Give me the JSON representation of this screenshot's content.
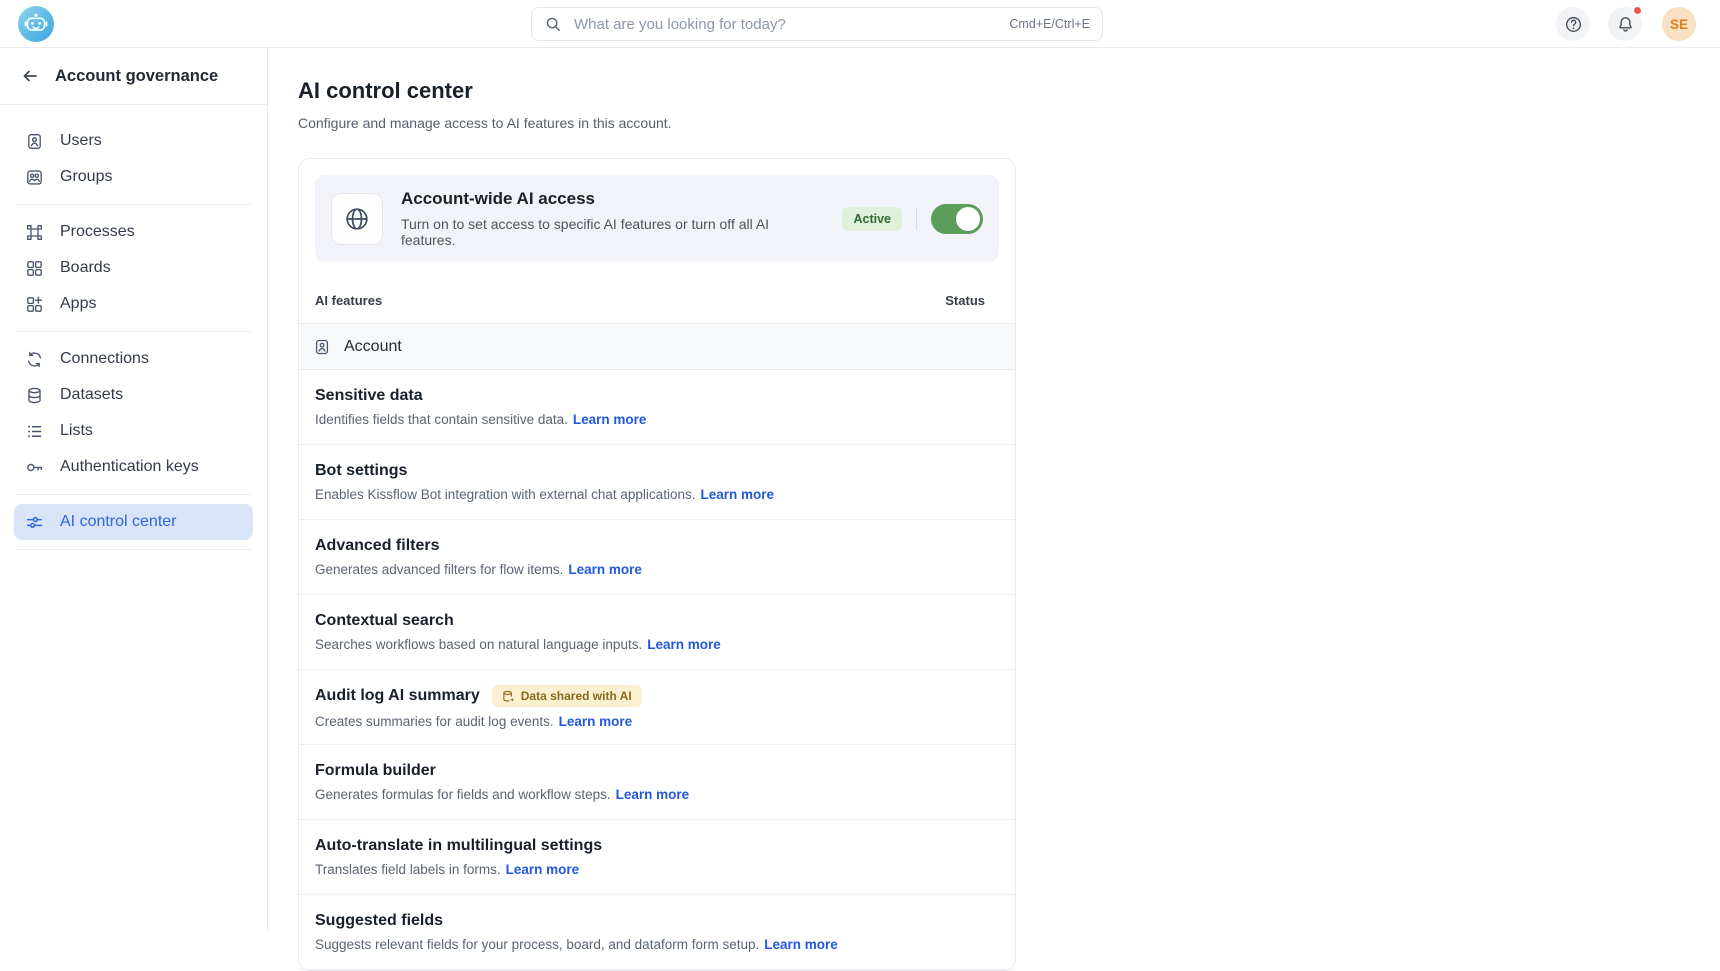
{
  "topbar": {
    "search": {
      "placeholder": "What are you looking for today?",
      "shortcut": "Cmd+E/Ctrl+E"
    },
    "avatar_initials": "SE",
    "has_notification": true
  },
  "sidebar": {
    "title": "Account governance",
    "items": [
      {
        "label": "Users",
        "icon": "user-badge-icon",
        "selected": false,
        "divider_after": false
      },
      {
        "label": "Groups",
        "icon": "users-group-icon",
        "selected": false,
        "divider_after": true
      },
      {
        "label": "Processes",
        "icon": "processes-icon",
        "selected": false,
        "divider_after": false
      },
      {
        "label": "Boards",
        "icon": "boards-icon",
        "selected": false,
        "divider_after": false
      },
      {
        "label": "Apps",
        "icon": "apps-icon",
        "selected": false,
        "divider_after": true
      },
      {
        "label": "Connections",
        "icon": "connections-icon",
        "selected": false,
        "divider_after": false
      },
      {
        "label": "Datasets",
        "icon": "datasets-icon",
        "selected": false,
        "divider_after": false
      },
      {
        "label": "Lists",
        "icon": "lists-icon",
        "selected": false,
        "divider_after": false
      },
      {
        "label": "Authentication keys",
        "icon": "key-icon",
        "selected": false,
        "divider_after": true
      },
      {
        "label": "AI control center",
        "icon": "sliders-icon",
        "selected": true,
        "divider_after": true
      }
    ]
  },
  "main": {
    "title": "AI control center",
    "subtitle": "Configure and manage access to AI features in this account.",
    "access_card": {
      "title": "Account-wide AI access",
      "description": "Turn on to set access to specific AI features or turn off all AI features.",
      "status_badge": "Active",
      "toggle_on": true
    },
    "table": {
      "column_features": "AI features",
      "column_status": "Status",
      "section_label": "Account",
      "rows": [
        {
          "name": "Sensitive data",
          "description": "Identifies fields that contain sensitive data.",
          "link": "Learn more",
          "toggle_on": true
        },
        {
          "name": "Bot settings",
          "description": "Enables Kissflow Bot integration with external chat applications.",
          "link": "Learn more",
          "toggle_on": true
        },
        {
          "name": "Advanced filters",
          "description": "Generates advanced filters for flow items.",
          "link": "Learn more",
          "toggle_on": true
        },
        {
          "name": "Contextual search",
          "description": "Searches workflows based on natural language inputs.",
          "link": "Learn more",
          "toggle_on": true
        },
        {
          "name": "Audit log AI summary",
          "badge": "Data shared with AI",
          "description": "Creates summaries for audit log events.",
          "link": "Learn more",
          "toggle_on": true
        },
        {
          "name": "Formula builder",
          "description": "Generates formulas for fields and workflow steps.",
          "link": "Learn more",
          "toggle_on": true
        },
        {
          "name": "Auto-translate in multilingual settings",
          "description": "Translates field labels in forms.",
          "link": "Learn more",
          "toggle_on": true
        },
        {
          "name": "Suggested fields",
          "description": "Suggests relevant fields for your process, board, and dataform form setup.",
          "link": "Learn more",
          "toggle_on": true
        }
      ]
    }
  },
  "colors": {
    "toggle_green": "#5B9E5C",
    "link_blue": "#2158DE",
    "selected_blue": "#2D66DD",
    "active_badge_bg": "#DFF0DB",
    "active_badge_text": "#2F6933",
    "data_badge_bg": "#FAF0D0",
    "data_badge_text": "#8A6A18",
    "notification_red": "#EB5A52"
  }
}
